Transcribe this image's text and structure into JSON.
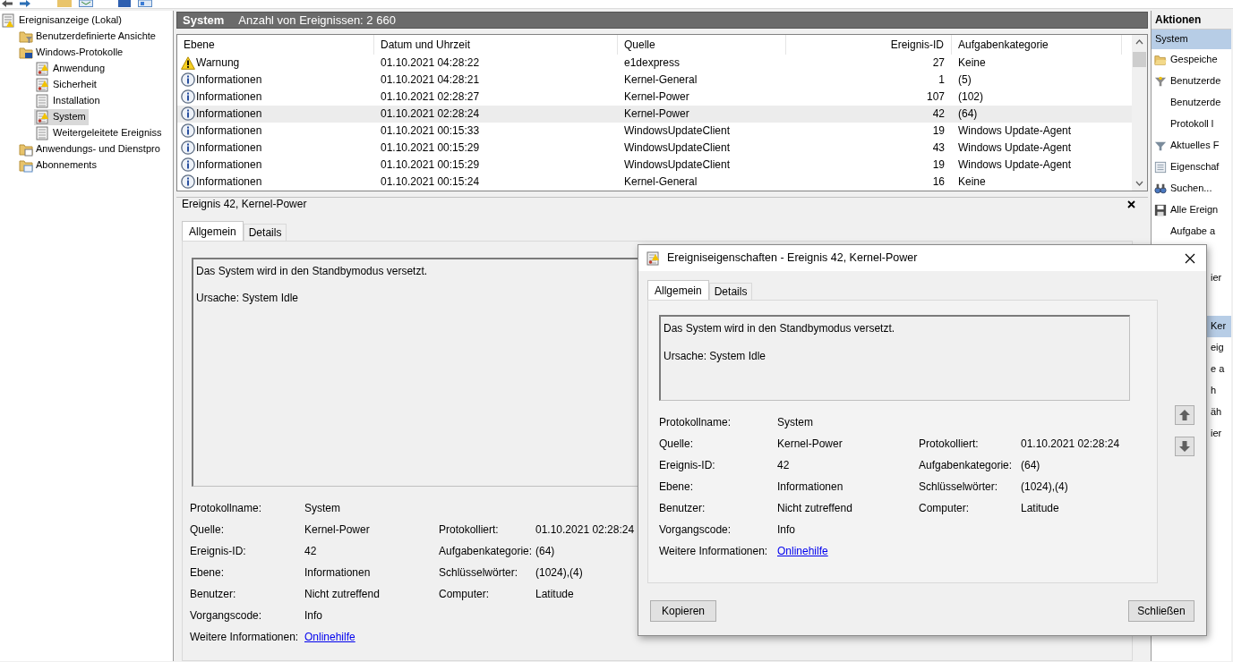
{
  "tree": [
    {
      "label": "Ereignisanzeige (Lokal)",
      "kind": "root",
      "selected": false,
      "children": [
        {
          "label": "Benutzerdefinierte Ansichte",
          "kind": "filter-folder",
          "selected": false
        },
        {
          "label": "Windows-Protokolle",
          "kind": "windows-folder",
          "selected": false,
          "children": [
            {
              "label": "Anwendung",
              "kind": "log",
              "selected": false
            },
            {
              "label": "Sicherheit",
              "kind": "log",
              "selected": false
            },
            {
              "label": "Installation",
              "kind": "plain-log",
              "selected": false
            },
            {
              "label": "System",
              "kind": "log",
              "selected": true
            },
            {
              "label": "Weitergeleitete Ereigniss",
              "kind": "plain-log",
              "selected": false
            }
          ]
        },
        {
          "label": "Anwendungs- und Dienstpro",
          "kind": "folder",
          "selected": false
        },
        {
          "label": "Abonnements",
          "kind": "subscription-folder",
          "selected": false
        }
      ]
    }
  ],
  "event_list": {
    "title": "System",
    "count": "Anzahl von Ereignissen: 2 660",
    "columns": [
      "Ebene",
      "Datum und Uhrzeit",
      "Quelle",
      "Ereignis-ID",
      "Aufgabenkategorie"
    ],
    "rows": [
      {
        "kind": "warning",
        "level": "Warnung",
        "date": "01.10.2021 04:28:22",
        "source": "e1dexpress",
        "id": "27",
        "category": "Keine",
        "selected": false
      },
      {
        "kind": "info",
        "level": "Informationen",
        "date": "01.10.2021 04:28:21",
        "source": "Kernel-General",
        "id": "1",
        "category": "(5)",
        "selected": false
      },
      {
        "kind": "info",
        "level": "Informationen",
        "date": "01.10.2021 02:28:27",
        "source": "Kernel-Power",
        "id": "107",
        "category": "(102)",
        "selected": false
      },
      {
        "kind": "info",
        "level": "Informationen",
        "date": "01.10.2021 02:28:24",
        "source": "Kernel-Power",
        "id": "42",
        "category": "(64)",
        "selected": true
      },
      {
        "kind": "info",
        "level": "Informationen",
        "date": "01.10.2021 00:15:33",
        "source": "WindowsUpdateClient",
        "id": "19",
        "category": "Windows Update-Agent",
        "selected": false
      },
      {
        "kind": "info",
        "level": "Informationen",
        "date": "01.10.2021 00:15:29",
        "source": "WindowsUpdateClient",
        "id": "43",
        "category": "Windows Update-Agent",
        "selected": false
      },
      {
        "kind": "info",
        "level": "Informationen",
        "date": "01.10.2021 00:15:29",
        "source": "WindowsUpdateClient",
        "id": "19",
        "category": "Windows Update-Agent",
        "selected": false
      },
      {
        "kind": "info",
        "level": "Informationen",
        "date": "01.10.2021 00:15:24",
        "source": "Kernel-General",
        "id": "16",
        "category": "Keine",
        "selected": false
      }
    ]
  },
  "detail": {
    "title": "Ereignis 42, Kernel-Power",
    "tabs": [
      {
        "label": "Allgemein",
        "selected": true
      },
      {
        "label": "Details",
        "selected": false
      }
    ],
    "message": [
      "Das System wird in den Standbymodus versetzt.",
      "Ursache: System Idle"
    ],
    "rows": [
      {
        "cells": [
          {
            "kind": "text",
            "label": "Protokollname:",
            "value": "System"
          }
        ]
      },
      {
        "cells": [
          {
            "kind": "text",
            "label": "Quelle:",
            "value": "Kernel-Power"
          },
          {
            "kind": "text",
            "label": "Protokolliert:",
            "value": "01.10.2021 02:28:24"
          }
        ]
      },
      {
        "cells": [
          {
            "kind": "text",
            "label": "Ereignis-ID:",
            "value": "42"
          },
          {
            "kind": "text",
            "label": "Aufgabenkategorie:",
            "value": "(64)"
          }
        ]
      },
      {
        "cells": [
          {
            "kind": "text",
            "label": "Ebene:",
            "value": "Informationen"
          },
          {
            "kind": "text",
            "label": "Schlüsselwörter:",
            "value": "(1024),(4)"
          }
        ]
      },
      {
        "cells": [
          {
            "kind": "text",
            "label": "Benutzer:",
            "value": "Nicht zutreffend"
          },
          {
            "kind": "text",
            "label": "Computer:",
            "value": "Latitude"
          }
        ]
      },
      {
        "cells": [
          {
            "kind": "text",
            "label": "Vorgangscode:",
            "value": "Info"
          }
        ]
      },
      {
        "cells": [
          {
            "kind": "link",
            "label": "Weitere Informationen:",
            "value": "Onlinehilfe"
          }
        ]
      }
    ]
  },
  "actions": {
    "title": "Aktionen",
    "items": [
      {
        "kind": "header",
        "label": "System"
      },
      {
        "kind": "folder",
        "label": "Gespeiche"
      },
      {
        "kind": "filter-add",
        "label": "Benutzerde"
      },
      {
        "kind": "plain",
        "label": "Benutzerde"
      },
      {
        "kind": "plain",
        "label": "Protokoll l"
      },
      {
        "kind": "filter",
        "label": "Aktuelles F"
      },
      {
        "kind": "properties",
        "label": "Eigenschaf"
      },
      {
        "kind": "find",
        "label": "Suchen..."
      },
      {
        "kind": "save",
        "label": "Alle Ereign"
      },
      {
        "kind": "plain",
        "label": "Aufgabe a"
      },
      {
        "kind": "covered",
        "label": "ier"
      },
      {
        "kind": "covered-header",
        "label": "Ker"
      },
      {
        "kind": "covered",
        "label": "eig"
      },
      {
        "kind": "covered",
        "label": "e a"
      },
      {
        "kind": "covered",
        "label": "h"
      },
      {
        "kind": "covered",
        "label": "äh"
      },
      {
        "kind": "covered",
        "label": "ier"
      }
    ]
  },
  "dialog": {
    "title": "Ereigniseigenschaften - Ereignis 42, Kernel-Power",
    "tabs": [
      {
        "label": "Allgemein",
        "selected": true
      },
      {
        "label": "Details",
        "selected": false
      }
    ],
    "message": [
      "Das System wird in den Standbymodus versetzt.",
      "Ursache: System Idle"
    ],
    "rows": [
      {
        "cells": [
          {
            "kind": "text",
            "label": "Protokollname:",
            "value": "System"
          }
        ]
      },
      {
        "cells": [
          {
            "kind": "text",
            "label": "Quelle:",
            "value": "Kernel-Power"
          },
          {
            "kind": "text",
            "label": "Protokolliert:",
            "value": "01.10.2021 02:28:24"
          }
        ]
      },
      {
        "cells": [
          {
            "kind": "text",
            "label": "Ereignis-ID:",
            "value": "42"
          },
          {
            "kind": "text",
            "label": "Aufgabenkategorie:",
            "value": "(64)"
          }
        ]
      },
      {
        "cells": [
          {
            "kind": "text",
            "label": "Ebene:",
            "value": "Informationen"
          },
          {
            "kind": "text",
            "label": "Schlüsselwörter:",
            "value": "(1024),(4)"
          }
        ]
      },
      {
        "cells": [
          {
            "kind": "text",
            "label": "Benutzer:",
            "value": "Nicht zutreffend"
          },
          {
            "kind": "text",
            "label": "Computer:",
            "value": "Latitude"
          }
        ]
      },
      {
        "cells": [
          {
            "kind": "text",
            "label": "Vorgangscode:",
            "value": "Info"
          }
        ]
      },
      {
        "cells": [
          {
            "kind": "link",
            "label": "Weitere Informationen:",
            "value": "Onlinehilfe"
          }
        ]
      }
    ],
    "buttons": [
      "Kopieren",
      "Schließen"
    ]
  }
}
